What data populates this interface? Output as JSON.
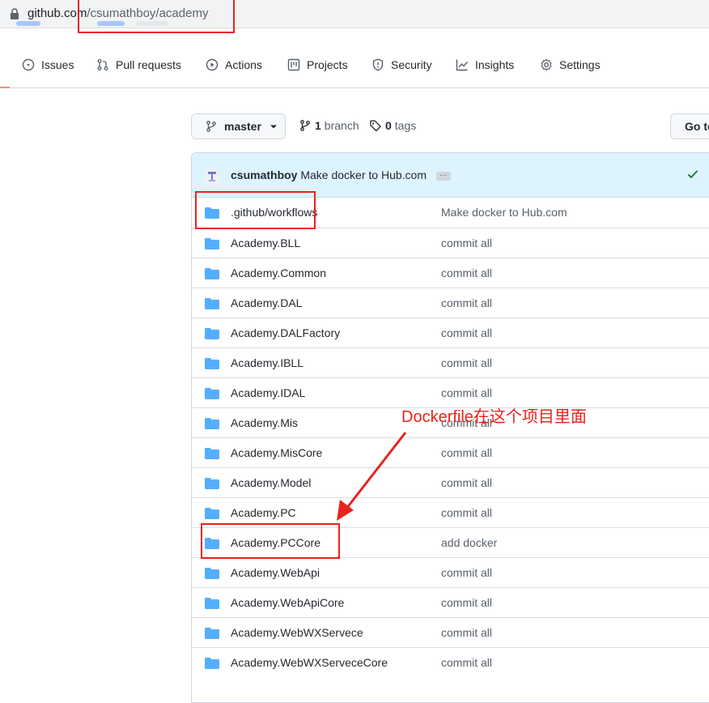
{
  "browser": {
    "url_host": "github.com",
    "url_path": "/csumathboy/academy",
    "lock_icon": "lock-icon"
  },
  "nav": {
    "tabs": [
      {
        "label": "Issues",
        "icon": "issue-icon"
      },
      {
        "label": "Pull requests",
        "icon": "pull-request-icon"
      },
      {
        "label": "Actions",
        "icon": "play-icon"
      },
      {
        "label": "Projects",
        "icon": "project-icon"
      },
      {
        "label": "Security",
        "icon": "shield-icon"
      },
      {
        "label": "Insights",
        "icon": "graph-icon"
      },
      {
        "label": "Settings",
        "icon": "gear-icon"
      }
    ]
  },
  "toolbar": {
    "branch_name": "master",
    "branch_count": "1",
    "branch_label": "branch",
    "tag_count": "0",
    "tag_label": "tags",
    "goto_label": "Go to file"
  },
  "commit": {
    "author": "csumathboy",
    "message": "Make docker to Hub.com",
    "ellipsis": "…"
  },
  "files": [
    {
      "name": ".github/workflows",
      "message": "Make docker to Hub.com"
    },
    {
      "name": "Academy.BLL",
      "message": "commit all"
    },
    {
      "name": "Academy.Common",
      "message": "commit all"
    },
    {
      "name": "Academy.DAL",
      "message": "commit all"
    },
    {
      "name": "Academy.DALFactory",
      "message": "commit all"
    },
    {
      "name": "Academy.IBLL",
      "message": "commit all"
    },
    {
      "name": "Academy.IDAL",
      "message": "commit all"
    },
    {
      "name": "Academy.Mis",
      "message": "commit all"
    },
    {
      "name": "Academy.MisCore",
      "message": "commit all"
    },
    {
      "name": "Academy.Model",
      "message": "commit all"
    },
    {
      "name": "Academy.PC",
      "message": "commit all"
    },
    {
      "name": "Academy.PCCore",
      "message": "add docker"
    },
    {
      "name": "Academy.WebApi",
      "message": "commit all"
    },
    {
      "name": "Academy.WebApiCore",
      "message": "commit all"
    },
    {
      "name": "Academy.WebWXServece",
      "message": "commit all"
    },
    {
      "name": "Academy.WebWXServeceCore",
      "message": "commit all"
    }
  ],
  "annotation": {
    "text": "Dockerfile在这个项目里面",
    "color": "#e8231b"
  },
  "colors": {
    "folder": "#54aeff",
    "commit_bar": "#ddf4ff",
    "nav_accent": "#fd8c73",
    "check": "#1a7f37"
  }
}
